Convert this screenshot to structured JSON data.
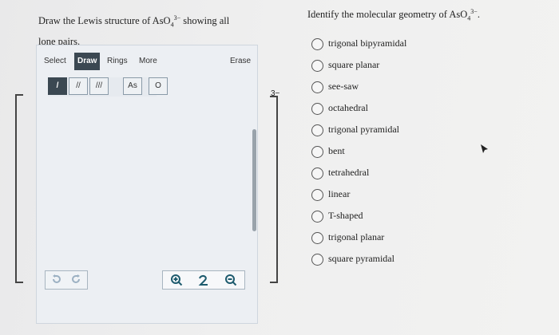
{
  "left_question": {
    "prefix": "Draw the Lewis structure of AsO",
    "sub": "4",
    "sup": "3−",
    "suffix": " showing all lone pairs."
  },
  "editor": {
    "menu": [
      "Select",
      "Draw",
      "Rings",
      "More"
    ],
    "erase_label": "Erase",
    "bond_tools": [
      "/",
      "//",
      "///"
    ],
    "atom_tools": [
      "As",
      "O"
    ],
    "charge_label": "3−"
  },
  "right_question": {
    "prefix": "Identify the molecular geometry of AsO",
    "sub": "4",
    "sup": "3−",
    "suffix": "."
  },
  "options": [
    "trigonal bipyramidal",
    "square planar",
    "see-saw",
    "octahedral",
    "trigonal pyramidal",
    "bent",
    "tetrahedral",
    "linear",
    "T-shaped",
    "trigonal planar",
    "square pyramidal"
  ],
  "icons": {
    "undo": "undo-icon",
    "redo": "redo-icon",
    "zoom_in": "zoom-in-icon",
    "reset": "reset-icon",
    "zoom_out": "zoom-out-icon"
  }
}
